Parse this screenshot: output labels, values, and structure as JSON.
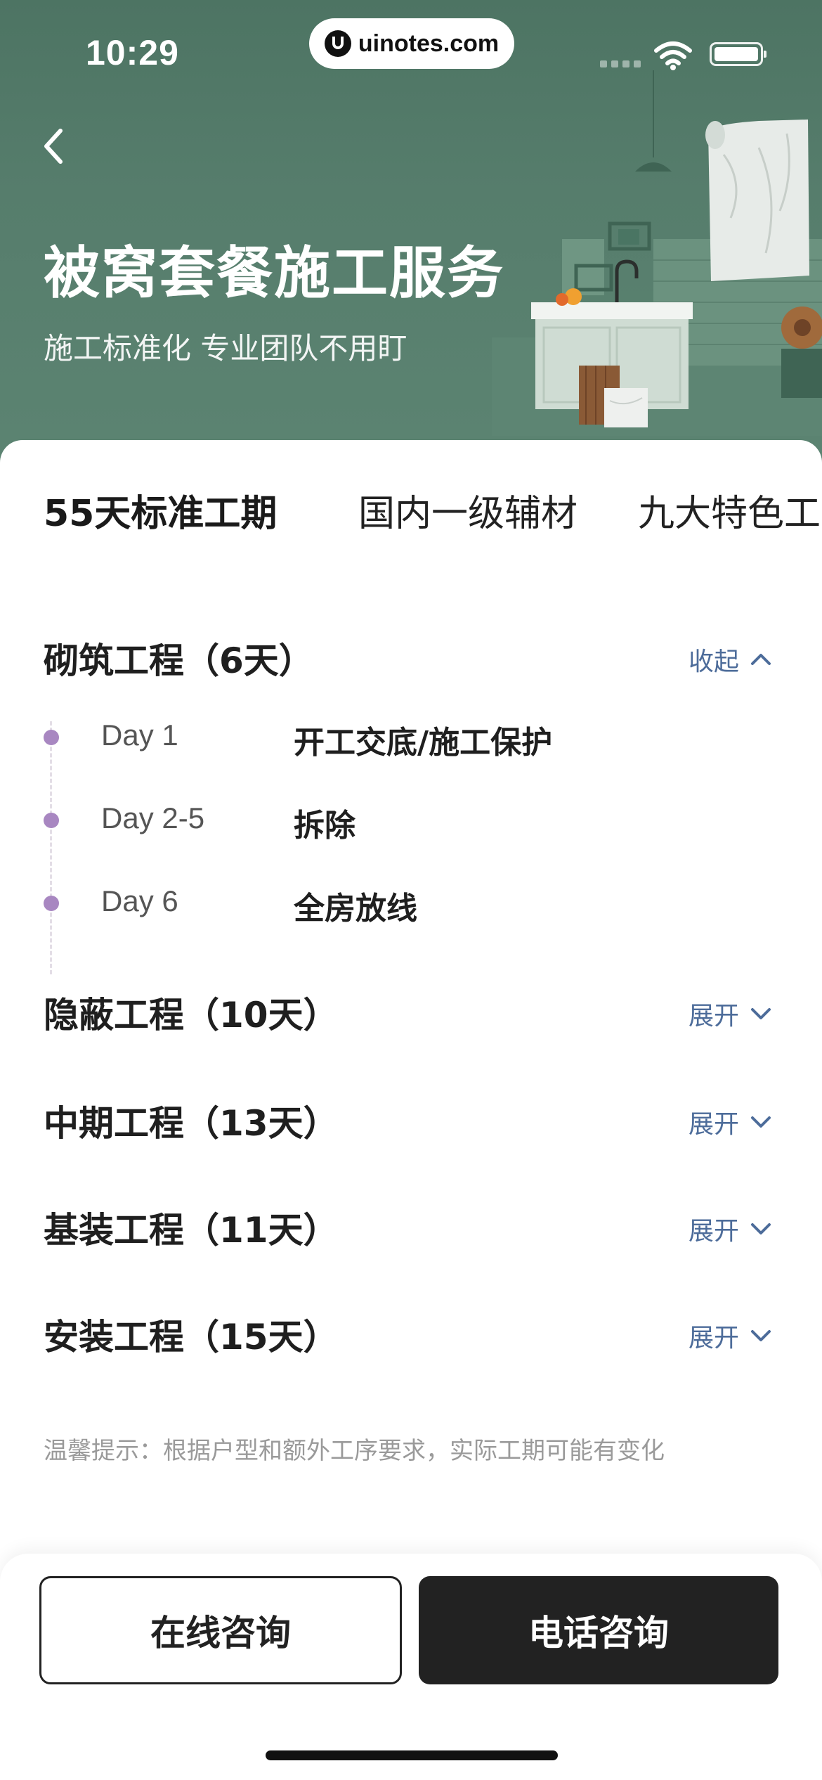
{
  "status_bar": {
    "time": "10:29",
    "url": "uinotes.com"
  },
  "header": {
    "title": "被窝套餐施工服务",
    "subtitle": "施工标准化 专业团队不用盯"
  },
  "tabs": [
    {
      "label": "55天标准工期",
      "active": true
    },
    {
      "label": "国内一级辅材",
      "active": false
    },
    {
      "label": "九大特色工艺",
      "active": false
    }
  ],
  "sections": [
    {
      "title": "砌筑工程（6天）",
      "toggle": "收起",
      "expanded": true,
      "items": [
        {
          "day": "Day 1",
          "task": "开工交底/施工保护"
        },
        {
          "day": "Day 2-5",
          "task": "拆除"
        },
        {
          "day": "Day 6",
          "task": "全房放线"
        }
      ]
    },
    {
      "title": "隐蔽工程（10天）",
      "toggle": "展开",
      "expanded": false
    },
    {
      "title": "中期工程（13天）",
      "toggle": "展开",
      "expanded": false
    },
    {
      "title": "基装工程（11天）",
      "toggle": "展开",
      "expanded": false
    },
    {
      "title": "安装工程（15天）",
      "toggle": "展开",
      "expanded": false
    }
  ],
  "tip": "温馨提示：根据户型和额外工序要求，实际工期可能有变化",
  "bottom_bar": {
    "online_label": "在线咨询",
    "phone_label": "电话咨询"
  },
  "colors": {
    "hero_bg": "#567d6c",
    "accent_link": "#4d6c9a",
    "timeline_dot": "#a887c1",
    "tab_underline": "#f7dc7a",
    "primary_button": "#222222"
  },
  "icons": {
    "back": "chevron-left-icon",
    "share": "share-external-icon",
    "collapse": "chevron-up-icon",
    "expand": "chevron-down-icon",
    "wifi": "wifi-icon",
    "battery": "battery-icon"
  }
}
